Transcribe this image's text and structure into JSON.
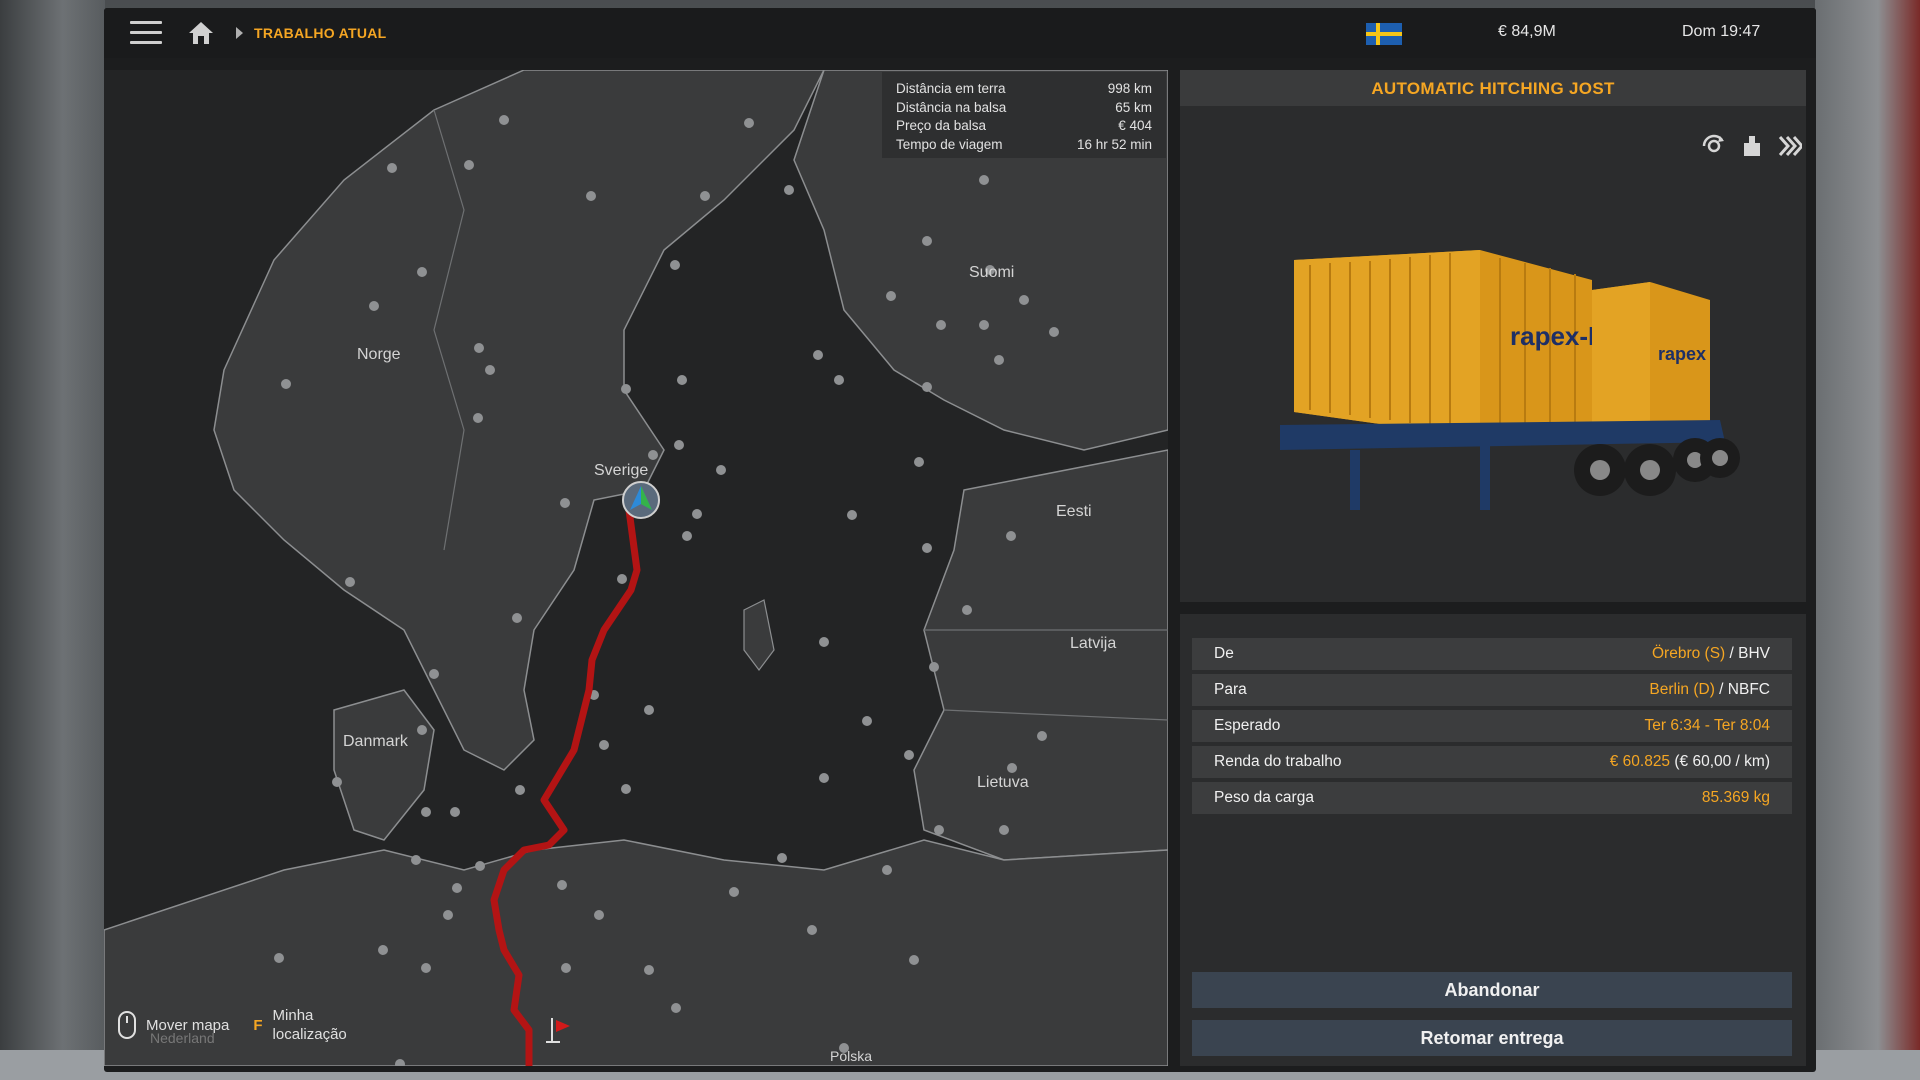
{
  "topbar": {
    "breadcrumb": "TRABALHO ATUAL",
    "money": "€ 84,9M",
    "clock": "Dom 19:47",
    "flag": "sweden-flag",
    "colors": {
      "accent": "#f5a623",
      "flag_blue": "#1d5fb0",
      "flag_yellow": "#f5c518"
    }
  },
  "map": {
    "route_color": "#b31414",
    "labels": {
      "norge": "Norge",
      "sverige": "Sverige",
      "suomi": "Suomi",
      "eesti": "Eesti",
      "latvija": "Latvija",
      "lietuva": "Lietuva",
      "danmark": "Danmark",
      "polska": "Polska",
      "nederland": "Nederland"
    },
    "info": {
      "land_label": "Distância em terra",
      "land_value": "998 km",
      "ferry_label": "Distância na balsa",
      "ferry_value": "65 km",
      "ferry_price_label": "Preço da balsa",
      "ferry_price_value": "€ 404",
      "time_label": "Tempo de viagem",
      "time_value": "16 hr 52 min"
    },
    "hints": {
      "move_map": "Mover mapa",
      "key": "F",
      "my_location_line1": "Minha",
      "my_location_line2": "localização"
    }
  },
  "trailer": {
    "title": "AUTOMATIC HITCHING JOST",
    "container_brand": "rapex-Lloyd",
    "container_color": "#d9961a",
    "chassis_color": "#1f3a66"
  },
  "details": {
    "from_label": "De",
    "from_city": "Örebro (S)",
    "from_company": " / BHV",
    "to_label": "Para",
    "to_city": "Berlin (D)",
    "to_company": " / NBFC",
    "expected_label": "Esperado",
    "expected_value": "Ter 6:34 - Ter 8:04",
    "income_label": "Renda do trabalho",
    "income_value": "€ 60.825",
    "income_rate": " (€ 60,00 / km)",
    "weight_label": "Peso da carga",
    "weight_value": "85.369 kg"
  },
  "actions": {
    "abandon": "Abandonar",
    "resume": "Retomar entrega"
  }
}
